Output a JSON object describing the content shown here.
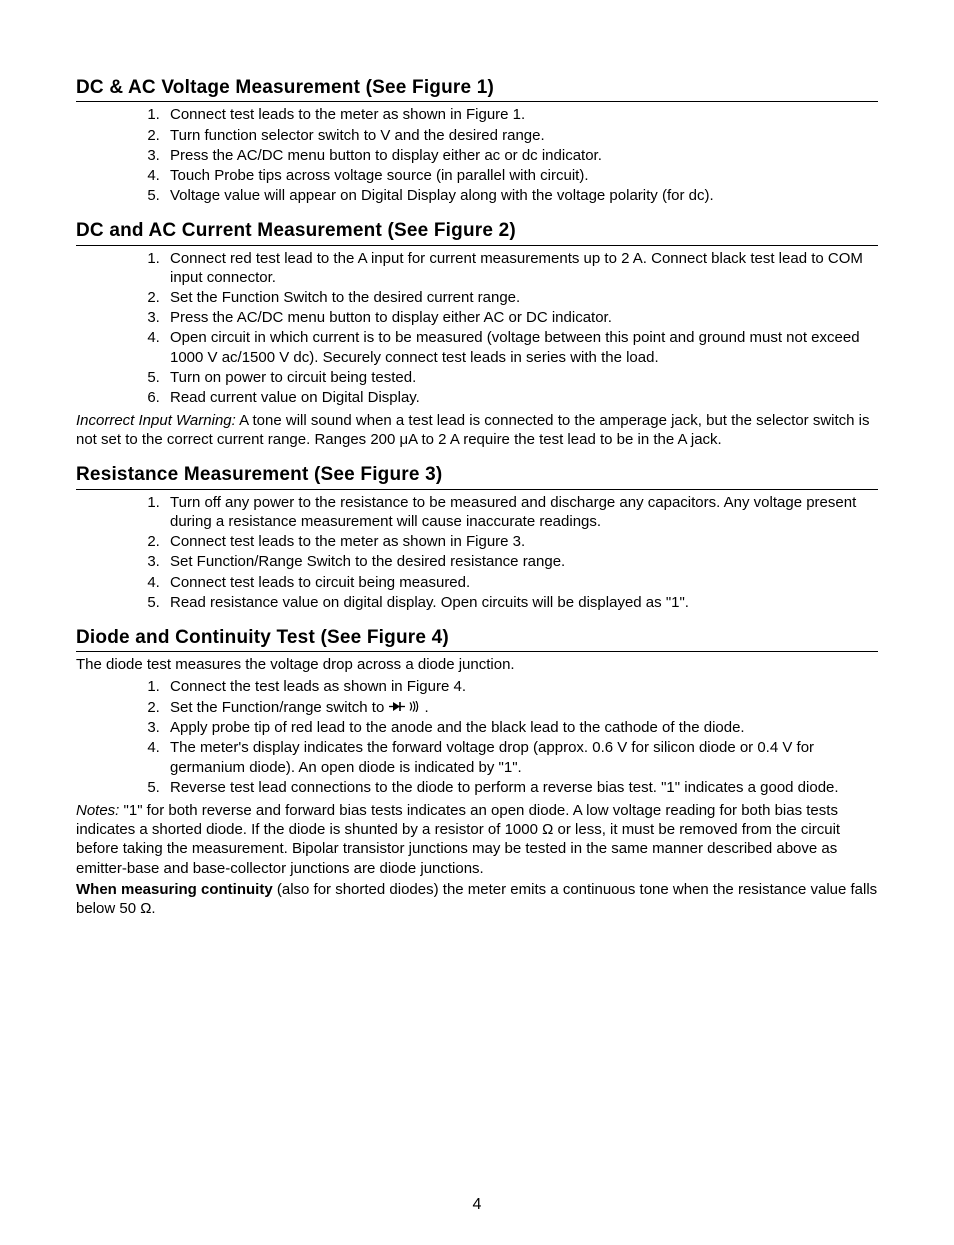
{
  "page_number": "4",
  "sections": [
    {
      "heading": "DC & AC Voltage Measurement (See Figure 1)",
      "items": [
        "Connect test leads to the meter as shown in Figure 1.",
        "Turn function selector switch to V and the desired range.",
        "Press the AC/DC menu button to display either ac or dc indicator.",
        "Touch Probe tips across voltage source (in parallel with circuit).",
        "Voltage value will appear on Digital Display along with the voltage polarity (for dc)."
      ]
    },
    {
      "heading": "DC and AC Current Measurement (See Figure 2)",
      "items": [
        "Connect red test lead to the A input for current measurements up to 2 A. Connect black test lead to COM input connector.",
        "Set the Function Switch to the desired current range.",
        "Press the AC/DC menu button to display either AC or DC indicator.",
        "Open circuit in which current is to be measured (voltage between this point and ground must not exceed 1000 V ac/1500 V dc). Securely connect test leads in series with the load.",
        "Turn on power to circuit being tested.",
        "Read current value on Digital Display."
      ],
      "after_label": "Incorrect Input Warning:",
      "after_text": " A tone will sound when a test lead is connected to the amperage jack, but the selector switch is not set to the correct current range. Ranges 200 μA to 2 A require the test lead to be in the A jack."
    },
    {
      "heading": "Resistance Measurement (See Figure 3)",
      "items": [
        "Turn off any power to the resistance to be measured and discharge any capacitors. Any voltage present during a resistance measurement will cause inaccurate readings.",
        "Connect test leads to the meter as shown in Figure 3.",
        "Set Function/Range Switch to the desired resistance range.",
        "Connect test leads to circuit being measured.",
        "Read resistance value on digital display. Open circuits will be displayed as \"1\"."
      ]
    },
    {
      "heading": "Diode and Continuity Test (See Figure 4)",
      "intro": "The diode test measures the voltage drop across a diode junction.",
      "items": [
        "Connect the test leads as shown in Figure 4.",
        "Set the Function/range switch to  ",
        "Apply probe tip of red lead to the anode and the black lead to the cathode of the diode.",
        "The meter's display indicates the forward voltage drop (approx. 0.6 V for silicon diode or 0.4 V for germanium diode). An open diode is indicated by \"1\".",
        "Reverse test lead connections to the diode to perform a reverse bias test. \"1\" indicates a good diode."
      ],
      "notes_label": "Notes:",
      "notes_text": " \"1\" for both reverse and forward bias tests indicates an open diode. A low voltage reading for both bias tests indicates a shorted diode. If the diode is shunted by a resistor of 1000 Ω or less, it must be removed from the circuit before taking the measurement. Bipolar transistor junctions may be tested in the same manner described above as emitter-base and base-collector junctions are diode junctions.",
      "cont_label": "When measuring continuity",
      "cont_text": " (also for shorted diodes) the meter emits a continuous tone when the resistance value falls below 50 Ω."
    }
  ],
  "icons": {
    "diode": "diode-icon",
    "sound": "sound-icon"
  }
}
